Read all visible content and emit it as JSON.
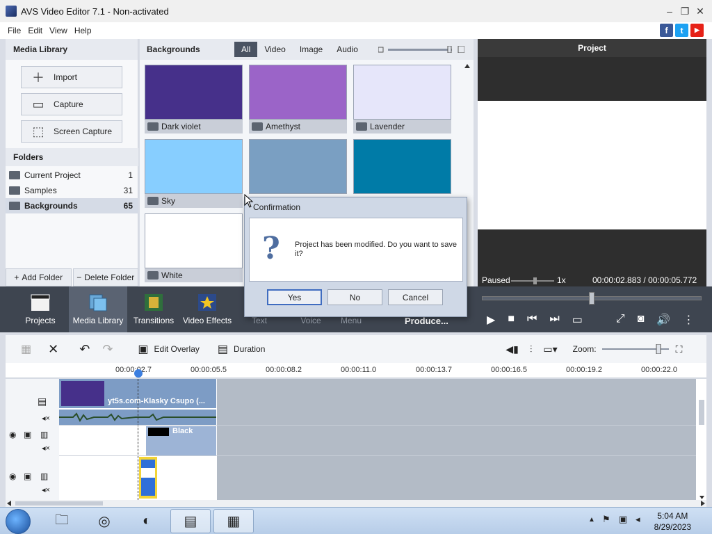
{
  "window": {
    "title": "AVS Video Editor 7.1 - Non-activated"
  },
  "menu": [
    "File",
    "Edit",
    "View",
    "Help"
  ],
  "social": [
    "f",
    "t",
    "▶"
  ],
  "media_library": {
    "heading": "Media Library",
    "buttons": [
      {
        "label": "Import",
        "icon": "plus-icon"
      },
      {
        "label": "Capture",
        "icon": "camera-icon"
      },
      {
        "label": "Screen Capture",
        "icon": "screen-capture-icon"
      }
    ],
    "folders_heading": "Folders",
    "folders": [
      {
        "name": "Current Project",
        "count": "1"
      },
      {
        "name": "Samples",
        "count": "31"
      },
      {
        "name": "Backgrounds",
        "count": "65"
      }
    ],
    "add_folder": "Add Folder",
    "delete_folder": "Delete Folder"
  },
  "backgrounds": {
    "heading": "Backgrounds",
    "filters": [
      "All",
      "Video",
      "Image",
      "Audio"
    ],
    "active_filter": "All",
    "tiles": [
      {
        "name": "Dark violet",
        "color": "#46308a"
      },
      {
        "name": "Amethyst",
        "color": "#9b64c8"
      },
      {
        "name": "Lavender",
        "color": "#e6e6fa"
      },
      {
        "name": "Sky",
        "color": "#87ceff"
      },
      {
        "name": "",
        "color": "#7a9fc2"
      },
      {
        "name": "",
        "color": "#007ba7"
      },
      {
        "name": "White",
        "color": "#ffffff"
      }
    ]
  },
  "preview": {
    "heading": "Project",
    "status": "Paused",
    "speed": "1x",
    "time": "00:00:02.883 / 00:00:05.772"
  },
  "toolbar": {
    "items": [
      "Projects",
      "Media Library",
      "Transitions",
      "Video Effects",
      "Text",
      "Voice",
      "Disc Menu"
    ],
    "produce": "Produce..."
  },
  "timeline": {
    "edit_overlay": "Edit Overlay",
    "duration": "Duration",
    "zoom_label": "Zoom:",
    "ticks": [
      "00:00:02.7",
      "00:00:05.5",
      "00:00:08.2",
      "00:00:11.0",
      "00:00:13.7",
      "00:00:16.5",
      "00:00:19.2",
      "00:00:22.0"
    ],
    "clip_label": "yt5s.com-Klasky Csupo (...",
    "overlay_label": "Black"
  },
  "dialog": {
    "title": "Confirmation",
    "message": "Project has been modified. Do you want to save it?",
    "yes": "Yes",
    "no": "No",
    "cancel": "Cancel"
  },
  "taskbar": {
    "time": "5:04 AM",
    "date": "8/29/2023"
  }
}
